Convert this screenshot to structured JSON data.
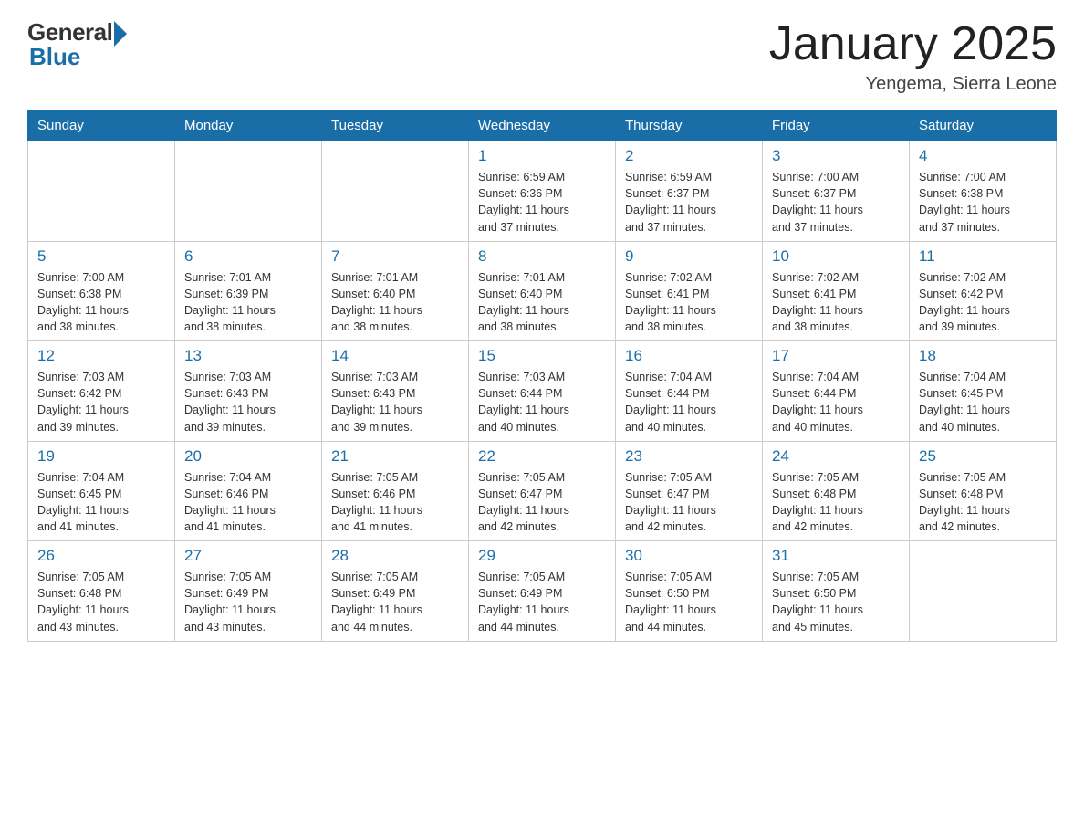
{
  "header": {
    "logo_general": "General",
    "logo_blue": "Blue",
    "month_title": "January 2025",
    "location": "Yengema, Sierra Leone"
  },
  "days_of_week": [
    "Sunday",
    "Monday",
    "Tuesday",
    "Wednesday",
    "Thursday",
    "Friday",
    "Saturday"
  ],
  "weeks": [
    [
      {
        "day": "",
        "info": ""
      },
      {
        "day": "",
        "info": ""
      },
      {
        "day": "",
        "info": ""
      },
      {
        "day": "1",
        "info": "Sunrise: 6:59 AM\nSunset: 6:36 PM\nDaylight: 11 hours\nand 37 minutes."
      },
      {
        "day": "2",
        "info": "Sunrise: 6:59 AM\nSunset: 6:37 PM\nDaylight: 11 hours\nand 37 minutes."
      },
      {
        "day": "3",
        "info": "Sunrise: 7:00 AM\nSunset: 6:37 PM\nDaylight: 11 hours\nand 37 minutes."
      },
      {
        "day": "4",
        "info": "Sunrise: 7:00 AM\nSunset: 6:38 PM\nDaylight: 11 hours\nand 37 minutes."
      }
    ],
    [
      {
        "day": "5",
        "info": "Sunrise: 7:00 AM\nSunset: 6:38 PM\nDaylight: 11 hours\nand 38 minutes."
      },
      {
        "day": "6",
        "info": "Sunrise: 7:01 AM\nSunset: 6:39 PM\nDaylight: 11 hours\nand 38 minutes."
      },
      {
        "day": "7",
        "info": "Sunrise: 7:01 AM\nSunset: 6:40 PM\nDaylight: 11 hours\nand 38 minutes."
      },
      {
        "day": "8",
        "info": "Sunrise: 7:01 AM\nSunset: 6:40 PM\nDaylight: 11 hours\nand 38 minutes."
      },
      {
        "day": "9",
        "info": "Sunrise: 7:02 AM\nSunset: 6:41 PM\nDaylight: 11 hours\nand 38 minutes."
      },
      {
        "day": "10",
        "info": "Sunrise: 7:02 AM\nSunset: 6:41 PM\nDaylight: 11 hours\nand 38 minutes."
      },
      {
        "day": "11",
        "info": "Sunrise: 7:02 AM\nSunset: 6:42 PM\nDaylight: 11 hours\nand 39 minutes."
      }
    ],
    [
      {
        "day": "12",
        "info": "Sunrise: 7:03 AM\nSunset: 6:42 PM\nDaylight: 11 hours\nand 39 minutes."
      },
      {
        "day": "13",
        "info": "Sunrise: 7:03 AM\nSunset: 6:43 PM\nDaylight: 11 hours\nand 39 minutes."
      },
      {
        "day": "14",
        "info": "Sunrise: 7:03 AM\nSunset: 6:43 PM\nDaylight: 11 hours\nand 39 minutes."
      },
      {
        "day": "15",
        "info": "Sunrise: 7:03 AM\nSunset: 6:44 PM\nDaylight: 11 hours\nand 40 minutes."
      },
      {
        "day": "16",
        "info": "Sunrise: 7:04 AM\nSunset: 6:44 PM\nDaylight: 11 hours\nand 40 minutes."
      },
      {
        "day": "17",
        "info": "Sunrise: 7:04 AM\nSunset: 6:44 PM\nDaylight: 11 hours\nand 40 minutes."
      },
      {
        "day": "18",
        "info": "Sunrise: 7:04 AM\nSunset: 6:45 PM\nDaylight: 11 hours\nand 40 minutes."
      }
    ],
    [
      {
        "day": "19",
        "info": "Sunrise: 7:04 AM\nSunset: 6:45 PM\nDaylight: 11 hours\nand 41 minutes."
      },
      {
        "day": "20",
        "info": "Sunrise: 7:04 AM\nSunset: 6:46 PM\nDaylight: 11 hours\nand 41 minutes."
      },
      {
        "day": "21",
        "info": "Sunrise: 7:05 AM\nSunset: 6:46 PM\nDaylight: 11 hours\nand 41 minutes."
      },
      {
        "day": "22",
        "info": "Sunrise: 7:05 AM\nSunset: 6:47 PM\nDaylight: 11 hours\nand 42 minutes."
      },
      {
        "day": "23",
        "info": "Sunrise: 7:05 AM\nSunset: 6:47 PM\nDaylight: 11 hours\nand 42 minutes."
      },
      {
        "day": "24",
        "info": "Sunrise: 7:05 AM\nSunset: 6:48 PM\nDaylight: 11 hours\nand 42 minutes."
      },
      {
        "day": "25",
        "info": "Sunrise: 7:05 AM\nSunset: 6:48 PM\nDaylight: 11 hours\nand 42 minutes."
      }
    ],
    [
      {
        "day": "26",
        "info": "Sunrise: 7:05 AM\nSunset: 6:48 PM\nDaylight: 11 hours\nand 43 minutes."
      },
      {
        "day": "27",
        "info": "Sunrise: 7:05 AM\nSunset: 6:49 PM\nDaylight: 11 hours\nand 43 minutes."
      },
      {
        "day": "28",
        "info": "Sunrise: 7:05 AM\nSunset: 6:49 PM\nDaylight: 11 hours\nand 44 minutes."
      },
      {
        "day": "29",
        "info": "Sunrise: 7:05 AM\nSunset: 6:49 PM\nDaylight: 11 hours\nand 44 minutes."
      },
      {
        "day": "30",
        "info": "Sunrise: 7:05 AM\nSunset: 6:50 PM\nDaylight: 11 hours\nand 44 minutes."
      },
      {
        "day": "31",
        "info": "Sunrise: 7:05 AM\nSunset: 6:50 PM\nDaylight: 11 hours\nand 45 minutes."
      },
      {
        "day": "",
        "info": ""
      }
    ]
  ]
}
